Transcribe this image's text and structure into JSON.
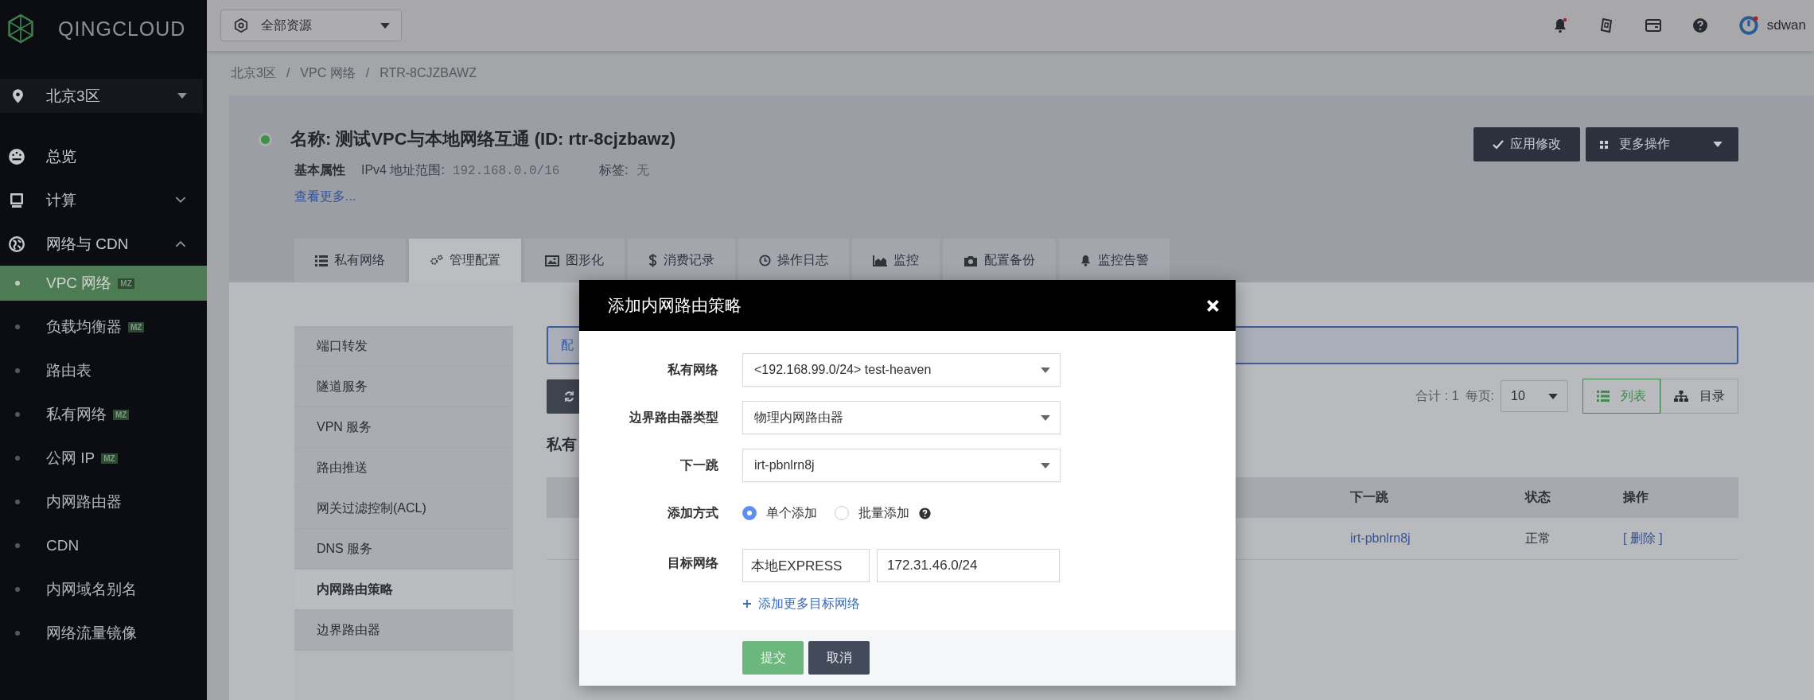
{
  "sidebar": {
    "logo": "QINGCLOUD",
    "region": "北京3区",
    "nav": [
      {
        "kind": "link",
        "label": "总览"
      },
      {
        "kind": "group",
        "label": "计算",
        "expanded": false
      },
      {
        "kind": "group",
        "label": "网络与 CDN",
        "expanded": true,
        "children": [
          {
            "label": "VPC 网络",
            "badge": "MZ",
            "selected": true
          },
          {
            "label": "负载均衡器",
            "badge": "MZ",
            "selected": false
          },
          {
            "label": "路由表",
            "selected": false
          },
          {
            "label": "私有网络",
            "badge": "MZ",
            "selected": false
          },
          {
            "label": "公网 IP",
            "badge": "MZ",
            "selected": false
          },
          {
            "label": "内网路由器",
            "selected": false
          },
          {
            "label": "CDN",
            "selected": false
          },
          {
            "label": "内网域名别名",
            "selected": false
          },
          {
            "label": "网络流量镜像",
            "selected": false
          }
        ]
      }
    ]
  },
  "header": {
    "resource_selector": "全部资源",
    "user": "sdwan"
  },
  "breadcrumb": {
    "items": [
      "北京3区",
      "VPC 网络",
      "RTR-8CJZBAWZ"
    ],
    "separators": [
      "/",
      "/"
    ]
  },
  "resource": {
    "active": true,
    "title": "名称: 测试VPC与本地网络互通 (ID: rtr-8cjzbawz)",
    "attributes_label": "基本属性",
    "attributes": [
      {
        "label": "IPv4 地址范围:",
        "value": "192.168.0.0/16"
      },
      {
        "label": "标签:",
        "value": "无"
      }
    ],
    "more_link": "查看更多...",
    "actions": [
      {
        "kind": "button",
        "label": "应用修改"
      },
      {
        "kind": "dropdown",
        "label": "更多操作"
      }
    ]
  },
  "tabs": [
    {
      "label": "私有网络",
      "selected": false
    },
    {
      "label": "管理配置",
      "selected": true
    },
    {
      "label": "图形化",
      "selected": false
    },
    {
      "label": "消费记录",
      "selected": false
    },
    {
      "label": "操作日志",
      "selected": false
    },
    {
      "label": "监控",
      "selected": false
    },
    {
      "label": "配置备份",
      "selected": false
    },
    {
      "label": "监控告警",
      "selected": false
    }
  ],
  "side_menu": [
    {
      "label": "端口转发",
      "selected": false
    },
    {
      "label": "隧道服务",
      "selected": false
    },
    {
      "label": "VPN 服务",
      "selected": false
    },
    {
      "label": "路由推送",
      "selected": false
    },
    {
      "label": "网关过滤控制(ACL)",
      "selected": false
    },
    {
      "label": "DNS 服务",
      "selected": false
    },
    {
      "label": "内网路由策略",
      "selected": true
    },
    {
      "label": "边界路由器",
      "selected": false
    }
  ],
  "panel": {
    "info_text": "配",
    "section_title": "私有",
    "total": "合计 : 1",
    "per_page_label": "每页:",
    "per_page": "10",
    "views": [
      {
        "label": "列表",
        "selected": true
      },
      {
        "label": "目录",
        "selected": false
      }
    ],
    "table": {
      "columns": [
        "下一跳",
        "状态",
        "操作"
      ],
      "rows": [
        [
          "irt-pbnlrn8j",
          "正常",
          "[ 删除 ]"
        ]
      ]
    }
  },
  "dialog": {
    "title": "添加内网路由策略",
    "fields": [
      {
        "kind": "select",
        "label": "私有网络",
        "value": "<192.168.99.0/24> test-heaven"
      },
      {
        "kind": "select",
        "label": "边界路由器类型",
        "value": "物理内网路由器"
      },
      {
        "kind": "select",
        "label": "下一跳",
        "value": "irt-pbnlrn8j"
      },
      {
        "kind": "radio",
        "label": "添加方式",
        "options": [
          {
            "label": "单个添加",
            "selected": true,
            "help": false
          },
          {
            "label": "批量添加",
            "selected": false,
            "help": true
          }
        ]
      },
      {
        "kind": "inputs",
        "label": "目标网络",
        "values": [
          "本地EXPRESS",
          "172.31.46.0/24"
        ]
      }
    ],
    "add_link": "添加更多目标网络",
    "buttons": [
      {
        "kind": "primary",
        "label": "提交"
      },
      {
        "kind": "secondary",
        "label": "取消"
      }
    ]
  }
}
